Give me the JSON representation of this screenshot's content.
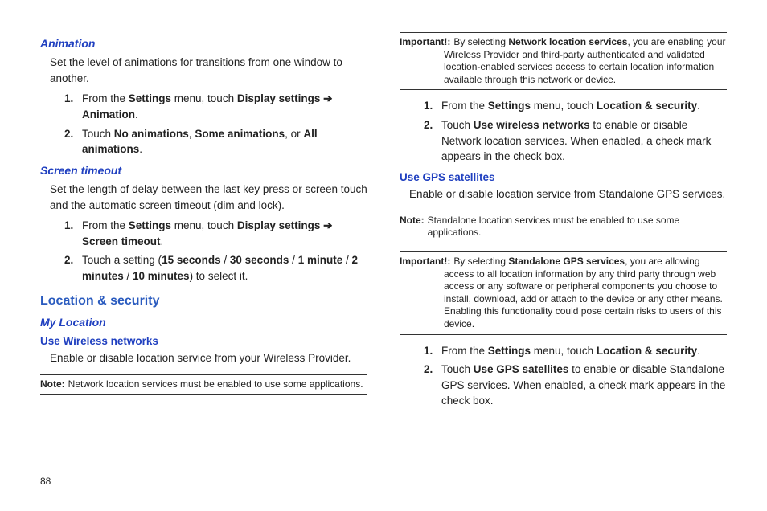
{
  "pageNumber": "88",
  "left": {
    "animation": {
      "heading": "Animation",
      "desc": "Set the level of animations for transitions from one window to another.",
      "steps": [
        {
          "n": "1.",
          "pre": "From the ",
          "b1": "Settings",
          "mid": " menu, touch ",
          "b2": "Display settings",
          "arrow": " ➔ ",
          "b3": "Animation",
          "post": "."
        },
        {
          "n": "2.",
          "pre": "Touch ",
          "b1": "No animations",
          "mid": ", ",
          "b2": "Some animations",
          "mid2": ", or ",
          "b3": "All animations",
          "post": "."
        }
      ]
    },
    "screenTimeout": {
      "heading": "Screen timeout",
      "desc": "Set the length of delay between the last key press or screen touch and the automatic screen timeout (dim and lock).",
      "steps": [
        {
          "n": "1.",
          "pre": "From the ",
          "b1": "Settings",
          "mid": " menu, touch ",
          "b2": "Display settings",
          "arrow": " ➔ ",
          "b3": "Screen timeout",
          "post": "."
        },
        {
          "n": "2.",
          "pre": "Touch a setting (",
          "b1": "15 seconds",
          "mid": " / ",
          "b2": "30 seconds",
          "mid2": " / ",
          "b3": "1 minute",
          "mid3": " / ",
          "b4": "2 minutes",
          "mid4": " / ",
          "b5": "10 minutes",
          "post": ") to select it."
        }
      ]
    },
    "locSec": {
      "heading": "Location & security",
      "myLocation": "My Location",
      "useWireless": "Use Wireless networks",
      "wirelessDesc": "Enable or disable location service from your Wireless Provider.",
      "note": {
        "label": "Note:",
        "text": "Network location services must be enabled to use some applications."
      }
    }
  },
  "right": {
    "important1": {
      "label": "Important!:",
      "pre": "By selecting ",
      "bold": "Network location services",
      "post": ", you are enabling your Wireless Provider and third-party authenticated and validated location-enabled services access to certain location information available through this network or device."
    },
    "steps1": [
      {
        "n": "1.",
        "pre": "From the ",
        "b1": "Settings",
        "mid": " menu, touch ",
        "b2": "Location & security",
        "post": "."
      },
      {
        "n": "2.",
        "pre": "Touch ",
        "b1": "Use wireless networks",
        "post": " to enable or disable Network location services. When enabled, a check mark appears in the check box."
      }
    ],
    "useGps": {
      "heading": "Use GPS satellites",
      "desc": "Enable or disable location service from Standalone GPS services."
    },
    "note2": {
      "label": "Note:",
      "text": "Standalone location services must be enabled to use some applications."
    },
    "important2": {
      "label": "Important!:",
      "pre": "By selecting ",
      "bold": "Standalone GPS services",
      "post": ", you are allowing access to all location information by any third party through web access or any software or peripheral components you choose to install, download, add or attach to the device or any other means. Enabling this functionality could pose certain risks to users of this device."
    },
    "steps2": [
      {
        "n": "1.",
        "pre": "From the ",
        "b1": "Settings",
        "mid": " menu, touch ",
        "b2": "Location & security",
        "post": "."
      },
      {
        "n": "2.",
        "pre": "Touch ",
        "b1": "Use GPS satellites",
        "post": " to enable or disable Standalone GPS services. When enabled, a check mark appears in the check box."
      }
    ]
  }
}
